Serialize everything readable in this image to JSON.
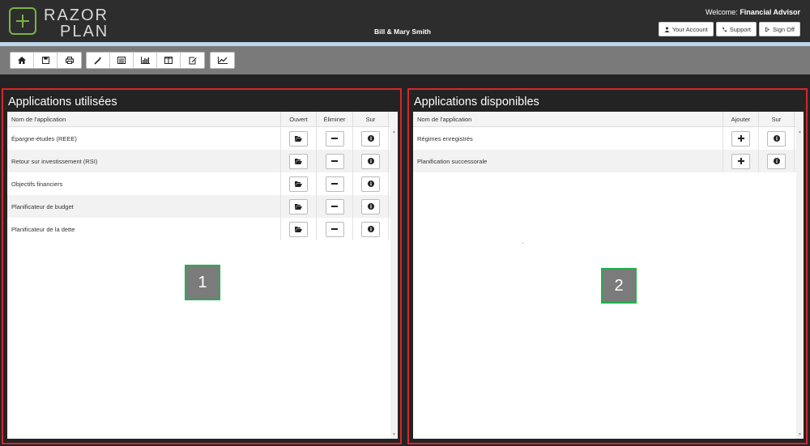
{
  "header": {
    "logo_line1": "RAZOR",
    "logo_line2": "PLAN",
    "client_name": "Bill & Mary Smith",
    "welcome_label": "Welcome:",
    "welcome_user": "Financial Advisor",
    "buttons": [
      {
        "label": "Your Account",
        "icon": "user-icon"
      },
      {
        "label": "Support",
        "icon": "phone-icon"
      },
      {
        "label": "Sign Off",
        "icon": "sign-out-icon"
      }
    ]
  },
  "toolbar": {
    "groups": [
      [
        "home-icon",
        "save-icon",
        "print-icon"
      ],
      [
        "wand-icon",
        "list-icon",
        "bar-chart-icon",
        "columns-icon",
        "edit-icon"
      ],
      [
        "line-chart-icon"
      ]
    ]
  },
  "used_apps": {
    "title": "Applications utilisées",
    "columns": [
      "Nom de l'application",
      "Ouvert",
      "Éliminer",
      "Sur"
    ],
    "rows": [
      "Épargne-études (REEE)",
      "Retour sur investissement (RSI)",
      "Objectifs financiers",
      "Planificateur de budget",
      "Planificateur de la dette"
    ],
    "badge": "1"
  },
  "available_apps": {
    "title": "Applications disponibles",
    "columns": [
      "Nom de l'application",
      "Ajouter",
      "Sur"
    ],
    "rows": [
      "Régimes enregistrés",
      "Planification successorale"
    ],
    "badge": "2"
  },
  "colors": {
    "accent_green": "#7cb342",
    "highlight_red": "#d7262b",
    "badge_border": "#22b14c"
  }
}
